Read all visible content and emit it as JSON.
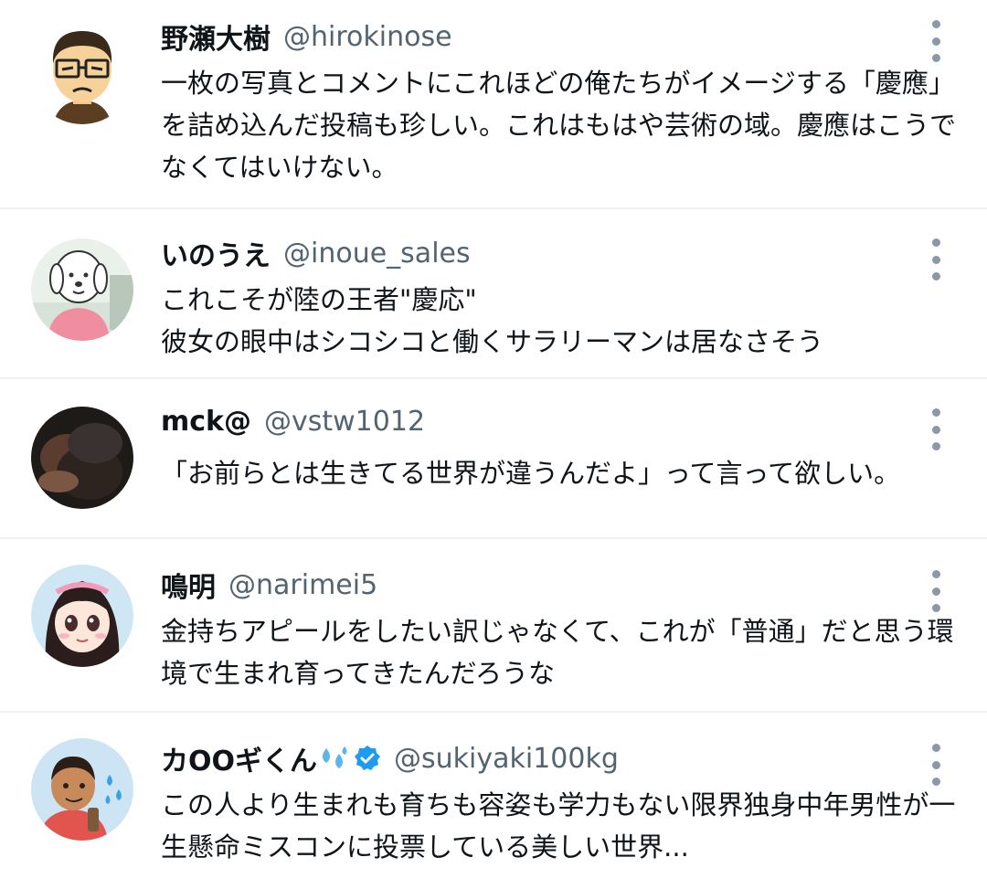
{
  "tweets": [
    {
      "name": "野瀬大樹",
      "handle": "@hirokinose",
      "text": "一枚の写真とコメントにこれほどの俺たちがイメージする「慶應」を詰め込んだ投稿も珍しい。これはもはや芸術の域。慶應はこうでなくてはいけない。",
      "avatar_icon": "mii-man-glasses-avatar"
    },
    {
      "name": "いのうえ",
      "handle": "@inoue_sales",
      "text": "これこそが陸の王者\"慶応\"\n彼女の眼中はシコシコと働くサラリーマンは居なさそう",
      "avatar_icon": "dog-character-avatar"
    },
    {
      "name": "mck@",
      "handle": "@vstw1012",
      "text": "「お前らとは生きてる世界が違うんだよ」って言って欲しい。",
      "avatar_icon": "dark-photo-avatar"
    },
    {
      "name": "鳴明",
      "handle": "@narimei5",
      "text": "金持ちアピールをしたい訳じゃなくて、これが「普通」だと思う環境で生まれ育ってきたんだろうな",
      "avatar_icon": "anime-girl-avatar"
    },
    {
      "name": "カOOギくん",
      "handle": "@sukiyaki100kg",
      "text": "この人より生まれも育ちも容姿も学力もない限界独身中年男性が一生懸命ミスコンに投票している美しい世界...",
      "avatar_icon": "cartoon-man-avatar",
      "name_emoji": "sweat-droplets-icon",
      "verified": true
    }
  ],
  "colors": {
    "text": "#0f1419",
    "handle": "#536471",
    "divider": "#eff3f4",
    "verified": "#1d9bf0",
    "more_dots": "#8b98a5"
  }
}
